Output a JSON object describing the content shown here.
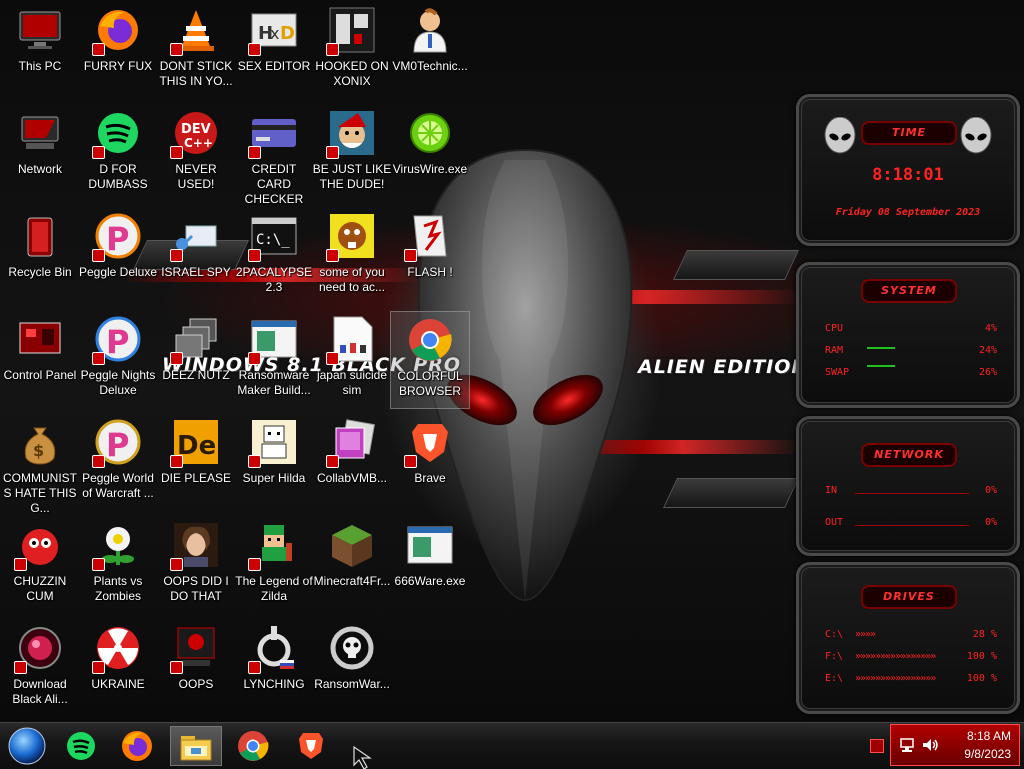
{
  "wallpaper": {
    "left_text": "WINDOWS 8.1 BLACK PRO",
    "right_text": "ALIEN EDITION 20"
  },
  "desktop_icons": [
    {
      "label": "This PC",
      "icon": "monitor-icon"
    },
    {
      "label": "FURRY FUX",
      "icon": "firefox-icon"
    },
    {
      "label": "DONT STICK THIS IN YO...",
      "icon": "vlc-cone-icon"
    },
    {
      "label": "SEX EDITOR",
      "icon": "hxd-icon"
    },
    {
      "label": "HOOKED ON XONIX",
      "icon": "xonix-icon"
    },
    {
      "label": "VM0Technic...",
      "icon": "doctor-icon"
    },
    {
      "label": "Network",
      "icon": "network-icon"
    },
    {
      "label": "D FOR DUMBASS",
      "icon": "spotify-icon"
    },
    {
      "label": "NEVER USED!",
      "icon": "dev-cpp-icon"
    },
    {
      "label": "CREDIT CARD CHECKER",
      "icon": "credit-card-icon"
    },
    {
      "label": "BE JUST LIKE THE DUDE!",
      "icon": "elf-icon"
    },
    {
      "label": "VirusWire.exe",
      "icon": "lime-icon"
    },
    {
      "label": "Recycle Bin",
      "icon": "recycle-bin-icon"
    },
    {
      "label": "Peggle Deluxe",
      "icon": "peggle-icon"
    },
    {
      "label": "ISRAEL SPY",
      "icon": "spy-icon"
    },
    {
      "label": "2PACALYPSE 2.3",
      "icon": "terminal-icon"
    },
    {
      "label": "some of you need to ac...",
      "icon": "beaver-icon"
    },
    {
      "label": "FLASH !",
      "icon": "flash-icon"
    },
    {
      "label": "Control Panel",
      "icon": "control-panel-icon"
    },
    {
      "label": "Peggle Nights Deluxe",
      "icon": "peggle-icon"
    },
    {
      "label": "DEEZ NUTZ",
      "icon": "windows-stack-icon"
    },
    {
      "label": "Ransomware Maker Build...",
      "icon": "app-window-icon"
    },
    {
      "label": "japan suicide sim",
      "icon": "document-icon"
    },
    {
      "label": "COLORFUL BROWSER",
      "icon": "chrome-icon"
    },
    {
      "label": "COMMUNISTS HATE THIS G...",
      "icon": "money-bag-icon"
    },
    {
      "label": "Peggle World of Warcraft ...",
      "icon": "peggle-icon"
    },
    {
      "label": "DIE PLEASE",
      "icon": "de-icon"
    },
    {
      "label": "Super Hilda",
      "icon": "pixel-character-icon"
    },
    {
      "label": "CollabVMB...",
      "icon": "collab-icon"
    },
    {
      "label": "Brave",
      "icon": "brave-icon"
    },
    {
      "label": "CHUZZIN CUM",
      "icon": "chuzzle-icon"
    },
    {
      "label": "Plants vs Zombies",
      "icon": "plant-icon"
    },
    {
      "label": "OOPS DID I DO THAT",
      "icon": "portrait-icon"
    },
    {
      "label": "The Legend of Zilda",
      "icon": "zelda-icon"
    },
    {
      "label": "Minecraft4Fr...",
      "icon": "minecraft-icon"
    },
    {
      "label": "666Ware.exe",
      "icon": "app-window-icon"
    },
    {
      "label": "Download Black Ali...",
      "icon": "alien-orb-icon"
    },
    {
      "label": "UKRAINE",
      "icon": "radiation-icon"
    },
    {
      "label": "OOPS",
      "icon": "skull-monitor-icon"
    },
    {
      "label": "LYNCHING",
      "icon": "noose-icon"
    },
    {
      "label": "RansomWar...",
      "icon": "skull-ring-icon"
    }
  ],
  "gadgets": {
    "time": {
      "title": "TIME",
      "time": "8:18:01",
      "date": "Friday 08 September 2023"
    },
    "system": {
      "title": "SYSTEM",
      "rows": [
        {
          "label": "CPU",
          "value": "4%",
          "pct": 4
        },
        {
          "label": "RAM",
          "value": "24%",
          "pct": 24
        },
        {
          "label": "SWAP",
          "value": "26%",
          "pct": 26
        }
      ]
    },
    "network": {
      "title": "NETWORK",
      "rows": [
        {
          "label": "IN",
          "value": "0%"
        },
        {
          "label": "OUT",
          "value": "0%"
        }
      ]
    },
    "drives": {
      "title": "DRIVES",
      "rows": [
        {
          "label": "C:\\",
          "value": "28 %",
          "pct": 28
        },
        {
          "label": "F:\\",
          "value": "100 %",
          "pct": 100
        },
        {
          "label": "E:\\",
          "value": "100 %",
          "pct": 100
        }
      ]
    }
  },
  "taskbar": {
    "pinned": [
      {
        "name": "start",
        "icon": "start-orb-icon"
      },
      {
        "name": "spotify",
        "icon": "spotify-icon"
      },
      {
        "name": "firefox",
        "icon": "firefox-icon"
      },
      {
        "name": "file-explorer",
        "icon": "folder-icon",
        "active": true
      },
      {
        "name": "chrome",
        "icon": "chrome-icon"
      },
      {
        "name": "brave",
        "icon": "brave-icon"
      }
    ],
    "clock": {
      "time": "8:18 AM",
      "date": "9/8/2023"
    }
  },
  "colors": {
    "accent_red": "#ff2222",
    "tray_red": "#b00000"
  }
}
